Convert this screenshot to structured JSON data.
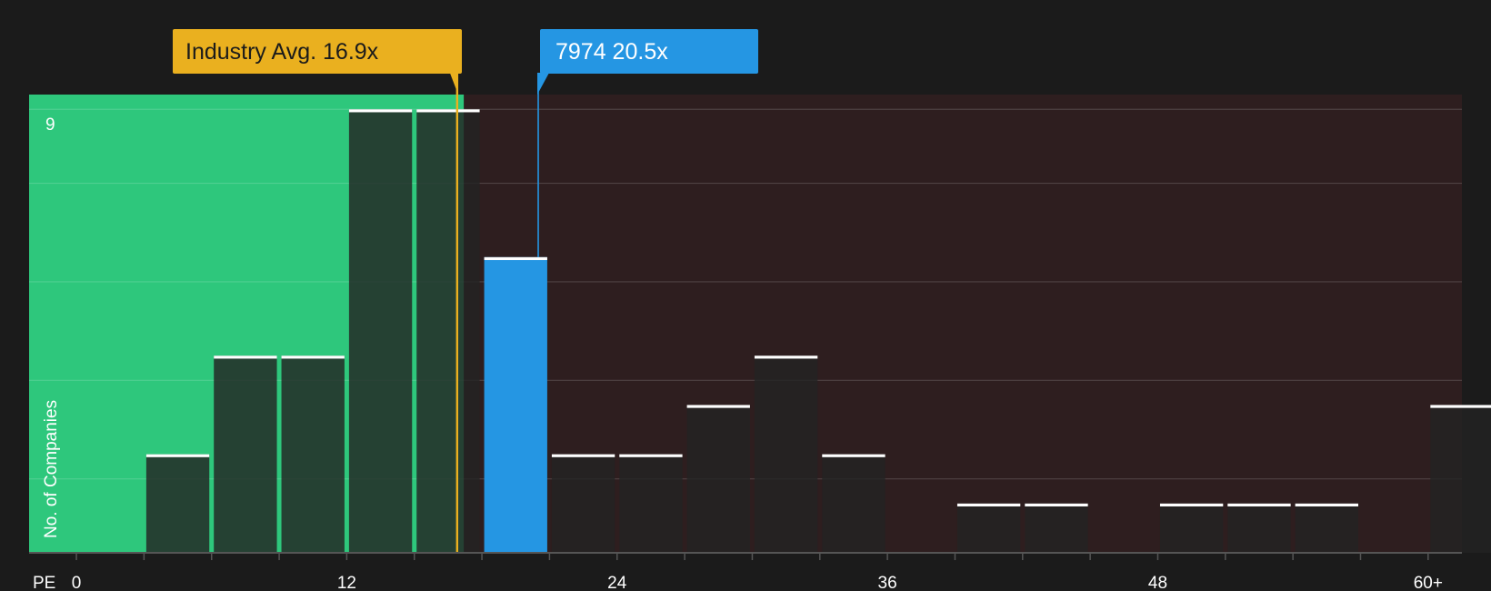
{
  "chart_data": {
    "type": "bar",
    "title": "",
    "xlabel": "PE",
    "ylabel": "No. of Companies",
    "x_ticks": [
      "0",
      "12",
      "24",
      "36",
      "48",
      "60+"
    ],
    "y_ticks": [
      "9"
    ],
    "xlim": [
      -2.1,
      61.5
    ],
    "ylim": [
      0,
      9.3
    ],
    "bin_width": 3,
    "bins": [
      {
        "start": 3,
        "count": 2
      },
      {
        "start": 6,
        "count": 4
      },
      {
        "start": 9,
        "count": 4
      },
      {
        "start": 12,
        "count": 9
      },
      {
        "start": 15,
        "count": 9
      },
      {
        "start": 18,
        "count": 6,
        "highlight": true
      },
      {
        "start": 21,
        "count": 2
      },
      {
        "start": 24,
        "count": 2
      },
      {
        "start": 27,
        "count": 3
      },
      {
        "start": 30,
        "count": 4
      },
      {
        "start": 33,
        "count": 2
      },
      {
        "start": 39,
        "count": 1
      },
      {
        "start": 42,
        "count": 1
      },
      {
        "start": 48,
        "count": 1
      },
      {
        "start": 51,
        "count": 1
      },
      {
        "start": 54,
        "count": 1
      },
      {
        "start": 60,
        "count": 3
      }
    ],
    "industry_avg": {
      "value": 16.9,
      "label": "Industry Avg. 16.9x"
    },
    "company": {
      "value": 20.5,
      "label": "7974 20.5x"
    },
    "colors": {
      "background": "#1b1b1b",
      "green_zone": "#2ec77c",
      "red_zone": "#2e1e1f",
      "bar": "#232323",
      "highlight": "#2596e3",
      "industry": "#eab01f",
      "cap": "#ffffff"
    }
  }
}
